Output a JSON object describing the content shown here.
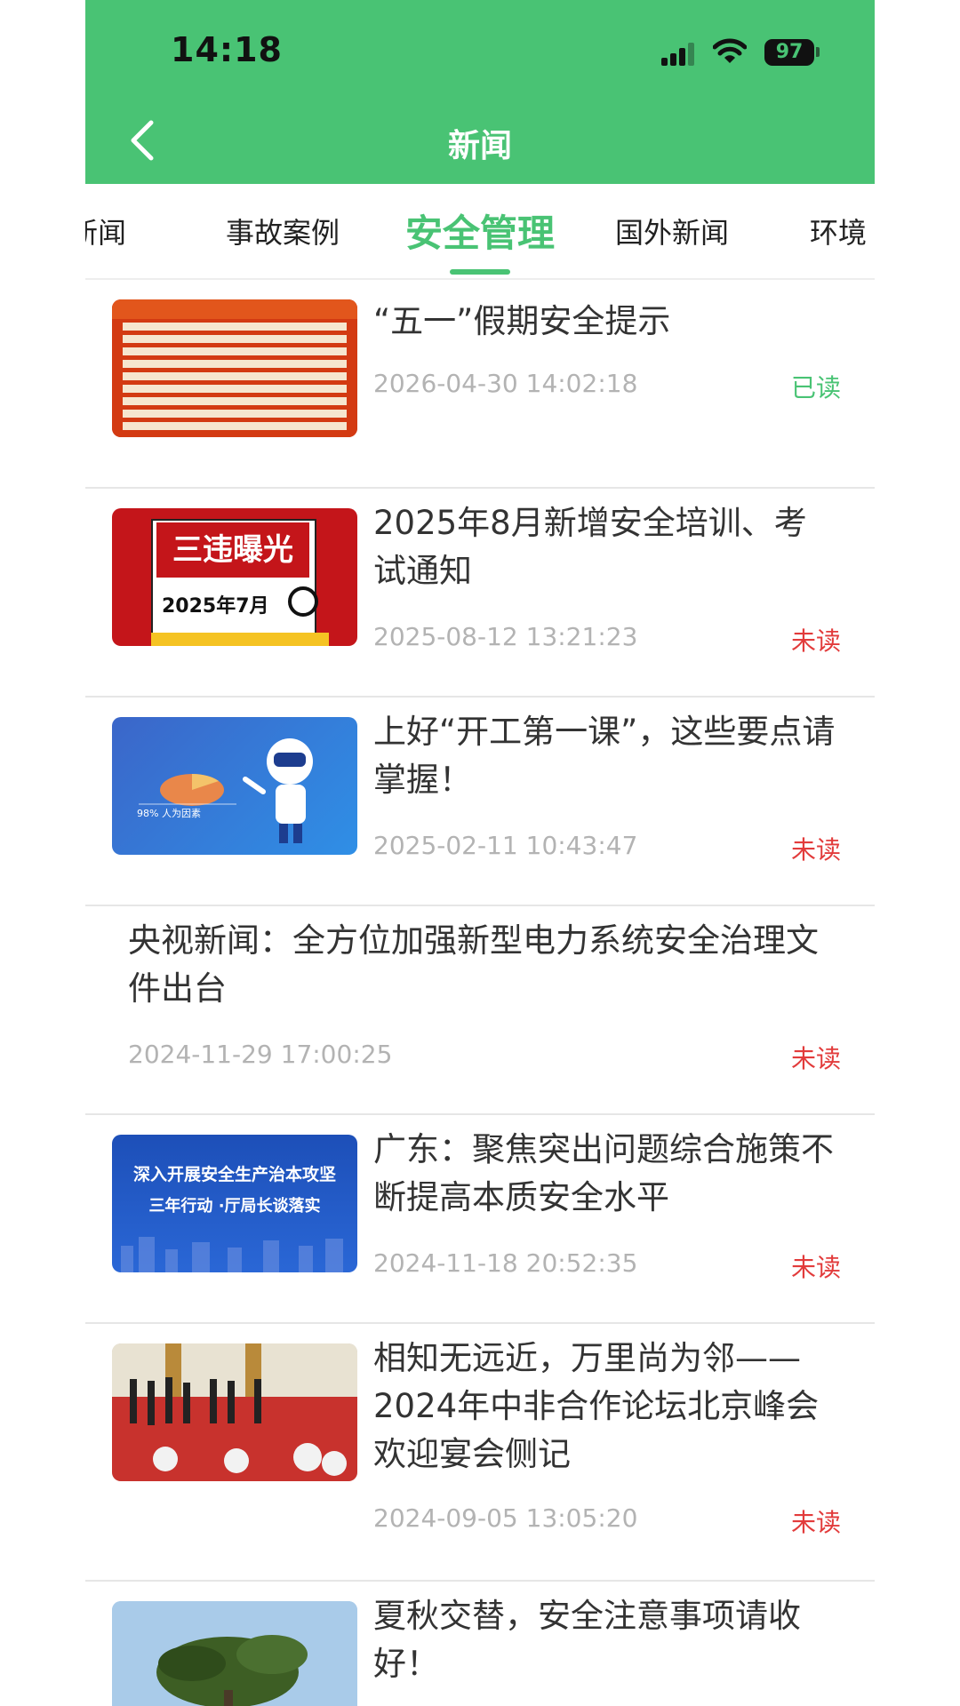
{
  "status_bar": {
    "time": "14:18",
    "battery": "97"
  },
  "header": {
    "title": "新闻"
  },
  "tabs": [
    {
      "label": "新闻"
    },
    {
      "label": "事故案例"
    },
    {
      "label": "安全管理"
    },
    {
      "label": "国外新闻"
    },
    {
      "label": "环境"
    }
  ],
  "active_tab": "安全管理",
  "thumbs": {
    "t2_title": "三违曝光",
    "t2_sub": "2025年7月",
    "t3_label": "98% 人为因素",
    "t5_line1": "深入开展安全生产治本攻坚",
    "t5_line2": "三年行动 ·厅局长谈落实"
  },
  "news": [
    {
      "title": "“五一”假期安全提示",
      "date": "2026-04-30 14:02:18",
      "status": "已读",
      "thumb": "orange-list"
    },
    {
      "title": "2025年8月新增安全培训、考试通知",
      "date": "2025-08-12 13:21:23",
      "status": "未读",
      "thumb": "violation-exposure"
    },
    {
      "title": "上好“开工第一课”，这些要点请掌握！",
      "date": "2025-02-11 10:43:47",
      "status": "未读",
      "thumb": "robot-chart"
    },
    {
      "title": "央视新闻：全方位加强新型电力系统安全治理文件出台",
      "date": "2024-11-29 17:00:25",
      "status": "未读",
      "thumb": null
    },
    {
      "title": "广东：聚焦突出问题综合施策不断提高本质安全水平",
      "date": "2024-11-18 20:52:35",
      "status": "未读",
      "thumb": "blue-banner"
    },
    {
      "title": "相知无远近，万里尚为邻——2024年中非合作论坛北京峰会欢迎宴会侧记",
      "date": "2024-09-05 13:05:20",
      "status": "未读",
      "thumb": "welcome-photo"
    },
    {
      "title": "夏秋交替，安全注意事项请收好！",
      "date": "",
      "status": "",
      "thumb": "tree-photo"
    }
  ],
  "colors": {
    "brand_green": "#49c374",
    "unread_red": "#e23b3b",
    "date_gray": "#b3b3b3"
  }
}
